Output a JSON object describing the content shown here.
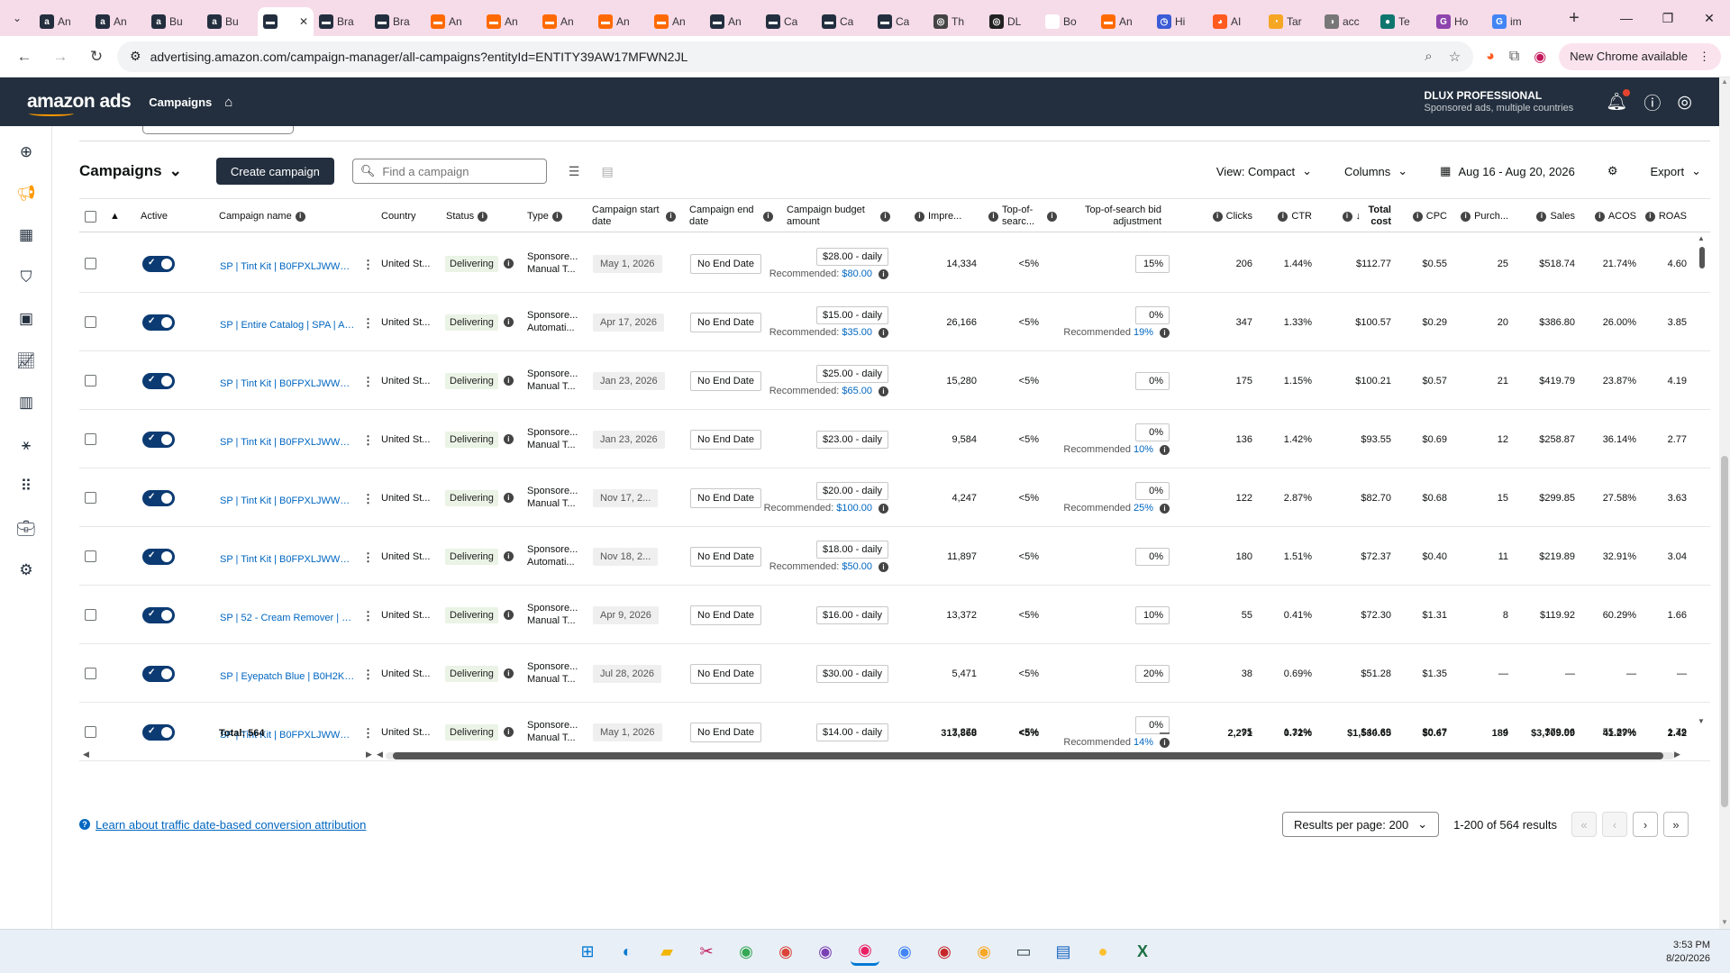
{
  "browser": {
    "tabs": [
      {
        "icon": "a",
        "title": "An",
        "color": "#232f3e"
      },
      {
        "icon": "a",
        "title": "An",
        "color": "#232f3e"
      },
      {
        "icon": "a",
        "title": "Bu",
        "color": "#232f3e"
      },
      {
        "icon": "a",
        "title": "Bu",
        "color": "#232f3e"
      },
      {
        "icon": "▬",
        "title": "",
        "color": "#232f3e",
        "active": true
      },
      {
        "icon": "▬",
        "title": "Bra",
        "color": "#232f3e"
      },
      {
        "icon": "▬",
        "title": "Bra",
        "color": "#232f3e"
      },
      {
        "icon": "▬",
        "title": "An",
        "color": "#ff6a00"
      },
      {
        "icon": "▬",
        "title": "An",
        "color": "#ff6a00"
      },
      {
        "icon": "▬",
        "title": "An",
        "color": "#ff6a00"
      },
      {
        "icon": "▬",
        "title": "An",
        "color": "#ff6a00"
      },
      {
        "icon": "▬",
        "title": "An",
        "color": "#ff6a00"
      },
      {
        "icon": "▬",
        "title": "An",
        "color": "#232f3e"
      },
      {
        "icon": "▬",
        "title": "Ca",
        "color": "#232f3e"
      },
      {
        "icon": "▬",
        "title": "Ca",
        "color": "#232f3e"
      },
      {
        "icon": "▬",
        "title": "Ca",
        "color": "#232f3e"
      },
      {
        "icon": "◎",
        "title": "Th",
        "color": "#444"
      },
      {
        "icon": "◎",
        "title": "DL",
        "color": "#222"
      },
      {
        "icon": "8",
        "title": "Bo",
        "color": "#fff"
      },
      {
        "icon": "▬",
        "title": "An",
        "color": "#ff6a00"
      },
      {
        "icon": "◷",
        "title": "Hi",
        "color": "#3c5bd6"
      },
      {
        "icon": "◕",
        "title": "AI",
        "color": "#ff5a1f"
      },
      {
        "icon": "◔",
        "title": "Tar",
        "color": "#f5a623"
      },
      {
        "icon": "◑",
        "title": "acc",
        "color": "#777"
      },
      {
        "icon": "●",
        "title": "Te",
        "color": "#0f766e"
      },
      {
        "icon": "G",
        "title": "Ho",
        "color": "#8e44ad"
      },
      {
        "icon": "G",
        "title": "im",
        "color": "#4285f4"
      }
    ],
    "url": "advertising.amazon.com/campaign-manager/all-campaigns?entityId=ENTITY39AW17MFWN2JL",
    "new_chrome": "New Chrome available"
  },
  "header": {
    "logo": "amazon ads",
    "nav": "Campaigns",
    "account_name": "DLUX PROFESSIONAL",
    "account_sub": "Sponsored ads, multiple countries"
  },
  "controls": {
    "title": "Campaigns",
    "create": "Create campaign",
    "search_placeholder": "Find a campaign",
    "view": "View: Compact",
    "columns": "Columns",
    "date_range": "Aug 16 - Aug 20, 2026",
    "export": "Export"
  },
  "columns": {
    "active": "Active",
    "name": "Campaign name",
    "country": "Country",
    "status": "Status",
    "type": "Type",
    "start": "Campaign start date",
    "end": "Campaign end date",
    "budget": "Campaign budget amount",
    "impr": "Impre...",
    "tos": "Top-of-searc...",
    "tos_adj": "Top-of-search bid adjustment",
    "clicks": "Clicks",
    "ctr": "CTR",
    "cost": "Total cost",
    "cpc": "CPC",
    "purch": "Purch...",
    "sales": "Sales",
    "acos": "ACOS",
    "roas": "ROAS"
  },
  "rows": [
    {
      "name": "SP | Tint Kit | B0FPXLJWWG |...",
      "country": "United St...",
      "status": "Delivering",
      "type1": "Sponsore...",
      "type2": "Manual T...",
      "start": "May 1, 2026",
      "end": "No End Date",
      "budget": "$28.00 - daily",
      "rec_budget": "$80.00",
      "impr": "14,334",
      "tos": "<5%",
      "adj": "15%",
      "rec_adj": "",
      "clicks": "206",
      "ctr": "1.44%",
      "cost": "$112.77",
      "cpc": "$0.55",
      "purch": "25",
      "sales": "$518.74",
      "acos": "21.74%",
      "roas": "4.60"
    },
    {
      "name": "SP | Entire Catalog | SPA | AU...",
      "country": "United St...",
      "status": "Delivering",
      "type1": "Sponsore...",
      "type2": "Automati...",
      "start": "Apr 17, 2026",
      "end": "No End Date",
      "budget": "$15.00 - daily",
      "rec_budget": "$35.00",
      "impr": "26,166",
      "tos": "<5%",
      "adj": "0%",
      "rec_adj": "19%",
      "clicks": "347",
      "ctr": "1.33%",
      "cost": "$100.57",
      "cpc": "$0.29",
      "purch": "20",
      "sales": "$386.80",
      "acos": "26.00%",
      "roas": "3.85"
    },
    {
      "name": "SP | Tint Kit | B0FPXLJWWG |...",
      "country": "United St...",
      "status": "Delivering",
      "type1": "Sponsore...",
      "type2": "Manual T...",
      "start": "Jan 23, 2026",
      "end": "No End Date",
      "budget": "$25.00 - daily",
      "rec_budget": "$65.00",
      "impr": "15,280",
      "tos": "<5%",
      "adj": "0%",
      "rec_adj": "",
      "clicks": "175",
      "ctr": "1.15%",
      "cost": "$100.21",
      "cpc": "$0.57",
      "purch": "21",
      "sales": "$419.79",
      "acos": "23.87%",
      "roas": "4.19"
    },
    {
      "name": "SP | Tint Kit | B0FPXLJWWG |...",
      "country": "United St...",
      "status": "Delivering",
      "type1": "Sponsore...",
      "type2": "Manual T...",
      "start": "Jan 23, 2026",
      "end": "No End Date",
      "budget": "$23.00 - daily",
      "rec_budget": "",
      "impr": "9,584",
      "tos": "<5%",
      "adj": "0%",
      "rec_adj": "10%",
      "clicks": "136",
      "ctr": "1.42%",
      "cost": "$93.55",
      "cpc": "$0.69",
      "purch": "12",
      "sales": "$258.87",
      "acos": "36.14%",
      "roas": "2.77"
    },
    {
      "name": "SP | Tint Kit | B0FPXLJWWG |...",
      "country": "United St...",
      "status": "Delivering",
      "type1": "Sponsore...",
      "type2": "Manual T...",
      "start": "Nov 17, 2...",
      "end": "No End Date",
      "budget": "$20.00 - daily",
      "rec_budget": "$100.00",
      "impr": "4,247",
      "tos": "<5%",
      "adj": "0%",
      "rec_adj": "25%",
      "clicks": "122",
      "ctr": "2.87%",
      "cost": "$82.70",
      "cpc": "$0.68",
      "purch": "15",
      "sales": "$299.85",
      "acos": "27.58%",
      "roas": "3.63"
    },
    {
      "name": "SP | Tint Kit | B0FPXLJWWG |...",
      "country": "United St...",
      "status": "Delivering",
      "type1": "Sponsore...",
      "type2": "Automati...",
      "start": "Nov 18, 2...",
      "end": "No End Date",
      "budget": "$18.00 - daily",
      "rec_budget": "$50.00",
      "impr": "11,897",
      "tos": "<5%",
      "adj": "0%",
      "rec_adj": "",
      "clicks": "180",
      "ctr": "1.51%",
      "cost": "$72.37",
      "cpc": "$0.40",
      "purch": "11",
      "sales": "$219.89",
      "acos": "32.91%",
      "roas": "3.04"
    },
    {
      "name": "SP | 52 - Cream Remover | B...",
      "country": "United St...",
      "status": "Delivering",
      "type1": "Sponsore...",
      "type2": "Manual T...",
      "start": "Apr 9, 2026",
      "end": "No End Date",
      "budget": "$16.00 - daily",
      "rec_budget": "",
      "impr": "13,372",
      "tos": "<5%",
      "adj": "10%",
      "rec_adj": "",
      "clicks": "55",
      "ctr": "0.41%",
      "cost": "$72.30",
      "cpc": "$1.31",
      "purch": "8",
      "sales": "$119.92",
      "acos": "60.29%",
      "roas": "1.66"
    },
    {
      "name": "SP | Eyepatch Blue | B0H2KB...",
      "country": "United St...",
      "status": "Delivering",
      "type1": "Sponsore...",
      "type2": "Manual T...",
      "start": "Jul 28, 2026",
      "end": "No End Date",
      "budget": "$30.00 - daily",
      "rec_budget": "",
      "impr": "5,471",
      "tos": "<5%",
      "adj": "20%",
      "rec_adj": "",
      "clicks": "38",
      "ctr": "0.69%",
      "cost": "$51.28",
      "cpc": "$1.35",
      "purch": "—",
      "sales": "—",
      "acos": "—",
      "roas": "—"
    },
    {
      "name": "SP | Tint Kit | B0FPXLJWWG |...",
      "country": "United St...",
      "status": "Delivering",
      "type1": "Sponsore...",
      "type2": "Manual T...",
      "start": "May 1, 2026",
      "end": "No End Date",
      "budget": "$14.00 - daily",
      "rec_budget": "",
      "impr": "7,270",
      "tos": "<5%",
      "adj": "0%",
      "rec_adj": "14%",
      "clicks": "95",
      "ctr": "1.31%",
      "cost": "$44.69",
      "cpc": "$0.47",
      "purch": "4",
      "sales": "$79.96",
      "acos": "55.89%",
      "roas": "1.79"
    }
  ],
  "recommended_label": "Recommended:",
  "recommended_adj_label": "Recommended",
  "totals": {
    "label": "Total: 564",
    "impr": "313,868",
    "tos": "<5%",
    "adj": "—",
    "clicks": "2,271",
    "ctr": "0.72%",
    "cost": "$1,530.65",
    "cpc": "$0.67",
    "purch": "189",
    "sales": "$3,709.09",
    "acos": "41.27%",
    "roas": "2.42"
  },
  "footer": {
    "learn": "Learn about traffic date-based conversion attribution",
    "rpp": "Results per page: 200",
    "range": "1-200 of 564 results"
  },
  "taskbar": {
    "time": "3:53 PM",
    "date": "8/20/2026"
  }
}
